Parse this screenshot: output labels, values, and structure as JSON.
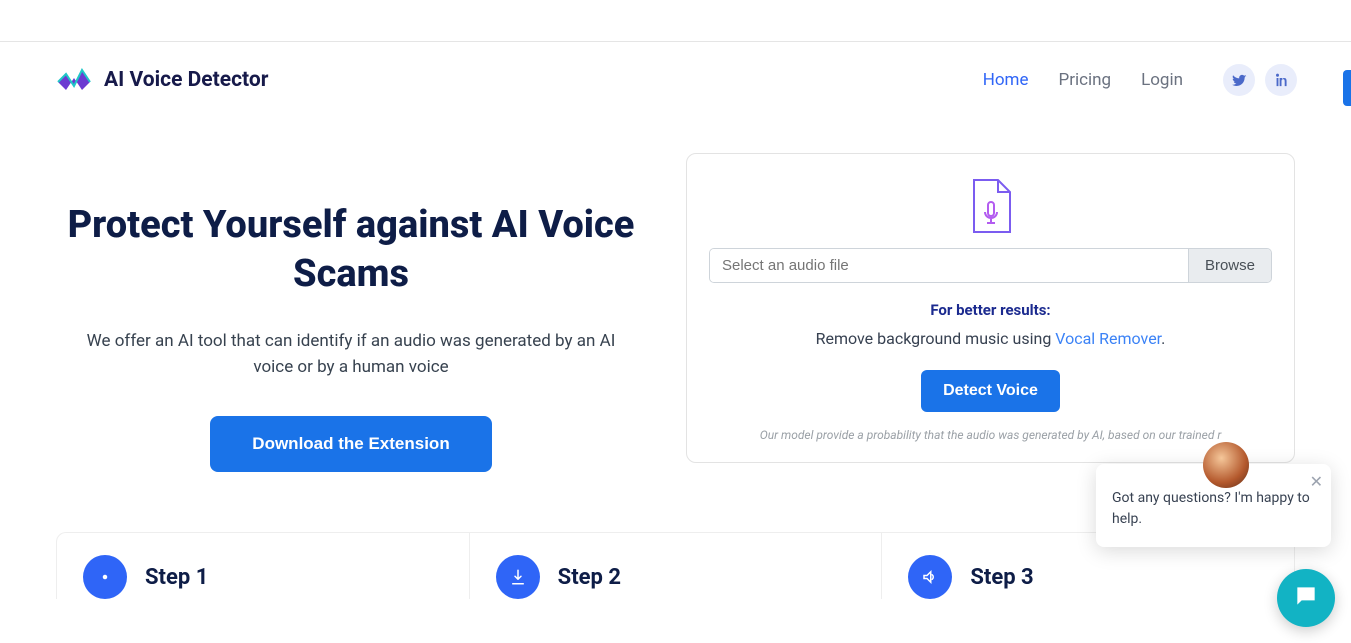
{
  "brand": {
    "name": "AI Voice Detector"
  },
  "nav": {
    "home": "Home",
    "pricing": "Pricing",
    "login": "Login"
  },
  "hero": {
    "title": "Protect Yourself against AI Voice Scams",
    "subtitle": "We offer an AI tool that can identify if an audio was generated by an AI voice or by a human voice",
    "cta": "Download the Extension"
  },
  "upload": {
    "placeholder": "Select an audio file",
    "browse": "Browse",
    "better_label": "For better results:",
    "better_text_1": "Remove background music using ",
    "better_link": "Vocal Remover",
    "better_text_2": ".",
    "detect": "Detect Voice",
    "disclaimer": "Our model provide a probability that the audio was generated by AI, based on our trained r"
  },
  "steps": {
    "s1": "Step 1",
    "s2": "Step 2",
    "s3": "Step 3"
  },
  "chat": {
    "message": "Got any questions? I'm happy to help."
  }
}
